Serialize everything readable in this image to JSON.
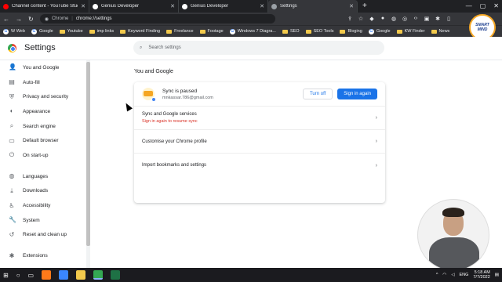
{
  "tabs": [
    {
      "label": "Channel content - YouTube Stud",
      "favicon_color": "#ff0000"
    },
    {
      "label": "Genius Developer",
      "favicon_color": "#ffffff"
    },
    {
      "label": "Genius Developer",
      "favicon_color": "#ffffff"
    },
    {
      "label": "Settings",
      "favicon_color": "#9aa0a6"
    }
  ],
  "toolbar": {
    "scheme": "Chrome",
    "separator": "|",
    "path": "chrome://settings"
  },
  "bookmarks": [
    {
      "label": "W Web",
      "type": "link"
    },
    {
      "label": "Google",
      "type": "google"
    },
    {
      "label": "Youtube",
      "type": "folder"
    },
    {
      "label": "imp links",
      "type": "folder"
    },
    {
      "label": "Keyword Finding",
      "type": "folder"
    },
    {
      "label": "Freelance",
      "type": "folder"
    },
    {
      "label": "Footage",
      "type": "folder"
    },
    {
      "label": "Windows 7 Diagra...",
      "type": "google"
    },
    {
      "label": "SEO",
      "type": "folder"
    },
    {
      "label": "SEO Tools",
      "type": "folder"
    },
    {
      "label": "Bloging",
      "type": "folder"
    },
    {
      "label": "Google",
      "type": "google"
    },
    {
      "label": "KW Finder",
      "type": "folder"
    },
    {
      "label": "News",
      "type": "folder"
    }
  ],
  "logo": {
    "line1": "SMART",
    "line2": "MIND"
  },
  "settings": {
    "title": "Settings",
    "search_placeholder": "Search settings",
    "nav": [
      {
        "label": "You and Google",
        "icon": "person-icon",
        "glyph": "👤"
      },
      {
        "label": "Auto-fill",
        "icon": "autofill-icon",
        "glyph": "▤"
      },
      {
        "label": "Privacy and security",
        "icon": "shield-icon",
        "glyph": "⛨"
      },
      {
        "label": "Appearance",
        "icon": "palette-icon",
        "glyph": "◐"
      },
      {
        "label": "Search engine",
        "icon": "search-icon",
        "glyph": "⌕"
      },
      {
        "label": "Default browser",
        "icon": "browser-icon",
        "glyph": "▭"
      },
      {
        "label": "On start-up",
        "icon": "power-icon",
        "glyph": "⏻"
      }
    ],
    "nav_advanced": [
      {
        "label": "Languages",
        "icon": "globe-icon",
        "glyph": "◍"
      },
      {
        "label": "Downloads",
        "icon": "download-icon",
        "glyph": "⤓"
      },
      {
        "label": "Accessibility",
        "icon": "accessibility-icon",
        "glyph": "♿"
      },
      {
        "label": "System",
        "icon": "wrench-icon",
        "glyph": "🔧"
      },
      {
        "label": "Reset and clean up",
        "icon": "reset-icon",
        "glyph": "↺"
      }
    ],
    "nav_extensions": {
      "label": "Extensions",
      "icon": "puzzle-icon",
      "glyph": "✱"
    },
    "section_title": "You and Google",
    "sync": {
      "status": "Sync is paused",
      "email": "mnkassar.786@gmail.com",
      "turn_off_label": "Turn off",
      "sign_in_label": "Sign in again"
    },
    "rows": [
      {
        "label": "Sync and Google services",
        "sub": "Sign in again to resume sync"
      },
      {
        "label": "Customise your Chrome profile",
        "sub": ""
      },
      {
        "label": "Import bookmarks and settings",
        "sub": ""
      }
    ]
  },
  "taskbar": {
    "language": "ENG",
    "time": "5:18 AM",
    "date": "7/7/2022"
  }
}
